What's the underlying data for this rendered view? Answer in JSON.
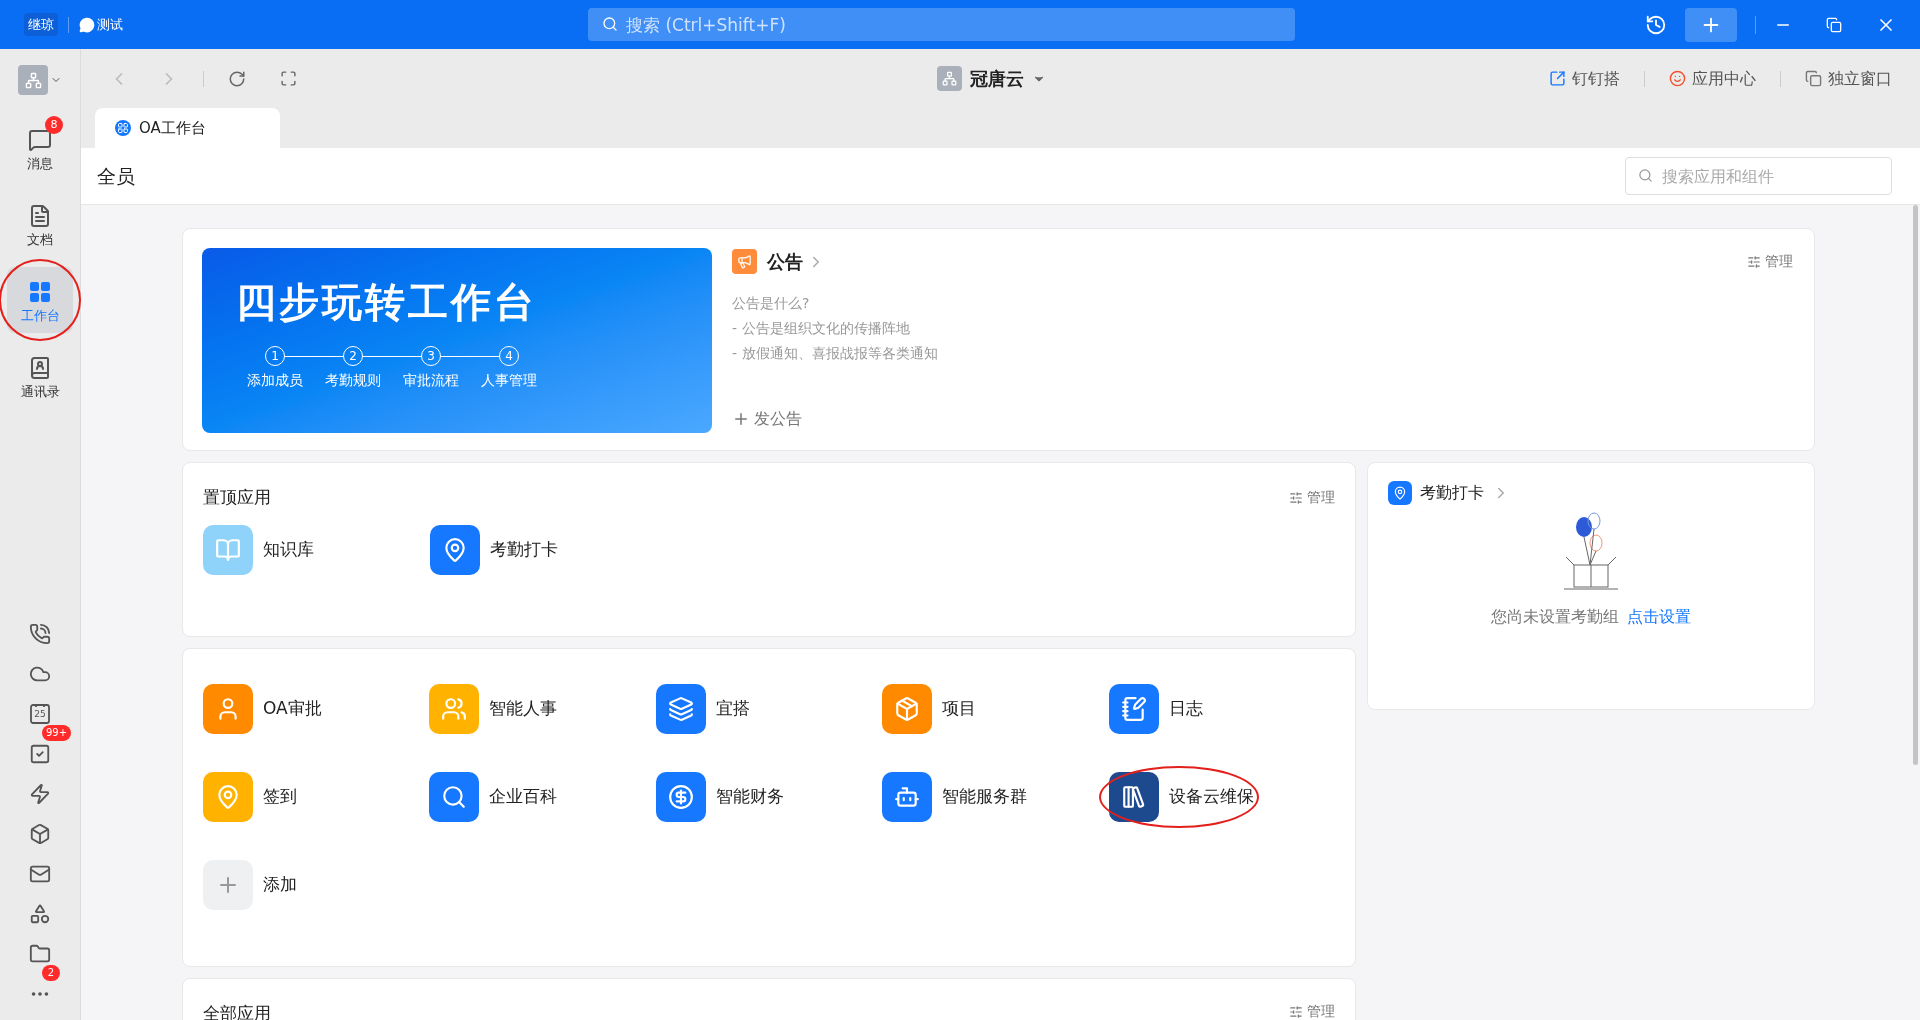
{
  "titlebar": {
    "logo_text": "继琼",
    "chat_label": "测试",
    "search": {
      "placeholder": "搜索 (Ctrl+Shift+F)"
    }
  },
  "sidebar": {
    "items": [
      {
        "label": "消息",
        "badge": "8",
        "selected": false,
        "circled": false
      },
      {
        "label": "文档",
        "selected": false,
        "circled": false
      },
      {
        "label": "工作台",
        "selected": true,
        "circled": true
      },
      {
        "label": "通讯录",
        "selected": false,
        "circled": false
      }
    ],
    "bottom_icons": [
      {
        "kind": "phone"
      },
      {
        "kind": "cloud"
      },
      {
        "kind": "calendar",
        "text": "25"
      },
      {
        "kind": "todo",
        "badge": "99+"
      },
      {
        "kind": "flash"
      },
      {
        "kind": "cube"
      },
      {
        "kind": "mail"
      },
      {
        "kind": "ding"
      },
      {
        "kind": "folder"
      },
      {
        "kind": "more",
        "badge": "2"
      }
    ]
  },
  "toolbar": {
    "org_name": "冠唐云",
    "actions": [
      "钉钉搭",
      "应用中心",
      "独立窗口"
    ]
  },
  "tabs": [
    {
      "label": "OA工作台",
      "selected": true
    }
  ],
  "header": {
    "title": "全员",
    "search": {
      "placeholder": "搜索应用和组件"
    }
  },
  "banner": {
    "title": "四步玩转工作台",
    "steps": [
      {
        "number": "1",
        "label": "添加成员"
      },
      {
        "number": "2",
        "label": "考勤规则"
      },
      {
        "number": "3",
        "label": "审批流程"
      },
      {
        "number": "4",
        "label": "人事管理"
      }
    ]
  },
  "announcement": {
    "title": "公告",
    "manage": "管理",
    "lines": [
      "公告是什么?",
      "- 公告是组织文化的传播阵地",
      "- 放假通知、喜报战报等各类通知"
    ],
    "post": "发公告"
  },
  "pinned_apps": {
    "title": "置顶应用",
    "manage": "管理",
    "apps": [
      {
        "name": "知识库",
        "color": "#8fd3fb"
      },
      {
        "name": "考勤打卡",
        "color": "#1677ff"
      }
    ]
  },
  "apps": [
    {
      "kind": "app",
      "name": "OA审批",
      "color": "#ff8a00",
      "circled": false
    },
    {
      "kind": "app",
      "name": "智能人事",
      "color": "#ffb300",
      "circled": false
    },
    {
      "kind": "app",
      "name": "宜搭",
      "color": "#1677ff",
      "circled": false
    },
    {
      "kind": "app",
      "name": "项目",
      "color": "#ff8a00",
      "circled": false
    },
    {
      "kind": "app",
      "name": "日志",
      "color": "#1677ff",
      "circled": false
    },
    {
      "kind": "app",
      "name": "签到",
      "color": "#ffb300",
      "circled": false
    },
    {
      "kind": "app",
      "name": "企业百科",
      "color": "#1677ff",
      "circled": false
    },
    {
      "kind": "app",
      "name": "智能财务",
      "color": "#1677ff",
      "circled": false
    },
    {
      "kind": "app",
      "name": "智能服务群",
      "color": "#1677ff",
      "circled": false
    },
    {
      "kind": "app",
      "name": "设备云维保",
      "color": "#1d4a8f",
      "circled": true
    },
    {
      "kind": "add",
      "name": "添加"
    }
  ],
  "attendance": {
    "title": "考勤打卡",
    "message": "您尚未设置考勤组",
    "link": "点击设置"
  },
  "all_apps": {
    "title": "全部应用",
    "manage": "管理"
  }
}
